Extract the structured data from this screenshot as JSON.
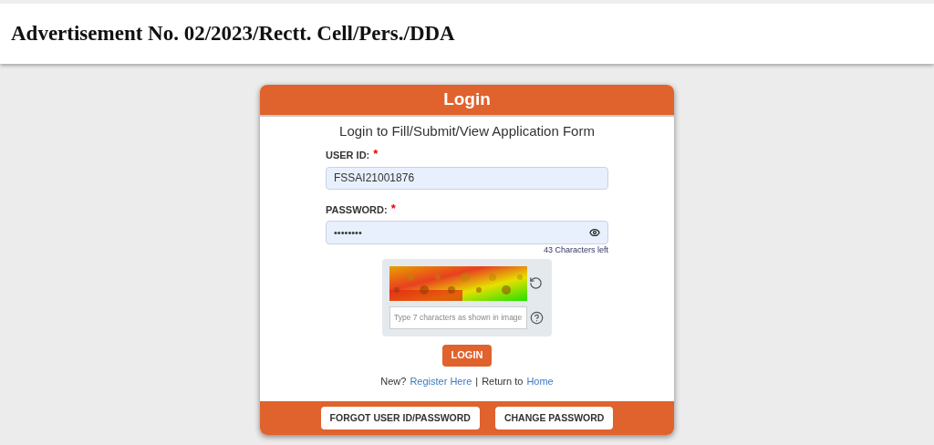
{
  "header": {
    "title": "Advertisement No. 02/2023/Rectt. Cell/Pers./DDA"
  },
  "login": {
    "title": "Login",
    "subtitle": "Login to Fill/Submit/View Application Form",
    "user_id": {
      "label": "USER ID:",
      "required_mark": "*",
      "value": "FSSAI21001876"
    },
    "password": {
      "label": "PASSWORD:",
      "required_mark": "*",
      "value": "••••••••",
      "counter": "43 Characters left"
    },
    "captcha": {
      "kind": "picture",
      "placeholder": "Type 7 characters as shown in image"
    },
    "submit": "LOGIN",
    "links": [
      {
        "prefix": "New?",
        "link": "Register Here"
      },
      {
        "separator": "|",
        "prefix": "Return to",
        "link": "Home"
      }
    ],
    "footer_buttons": [
      "FORGOT USER ID/PASSWORD",
      "CHANGE PASSWORD"
    ]
  }
}
